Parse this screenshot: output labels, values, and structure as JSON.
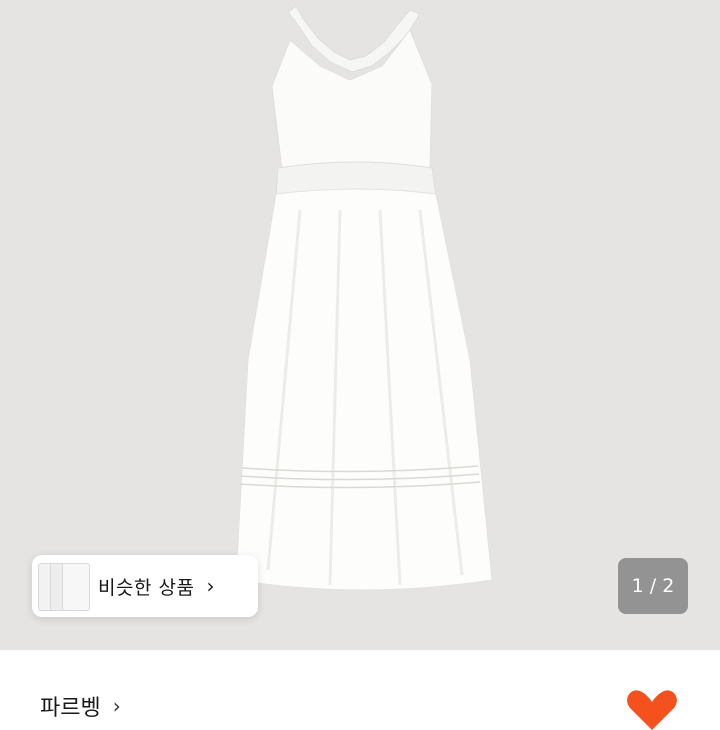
{
  "similar_products": {
    "label": "비슷한 상품",
    "chevron": "›"
  },
  "image_counter": {
    "text": "1 / 2",
    "current": 1,
    "total": 2
  },
  "shop": {
    "name": "파르벵",
    "chevron": "›"
  },
  "icons": {
    "heart": "heart-icon",
    "chevron": "chevron-right-icon"
  },
  "colors": {
    "photo_background": "#e5e4e2",
    "heart": "#f4511e",
    "counter_background": "#787878"
  }
}
